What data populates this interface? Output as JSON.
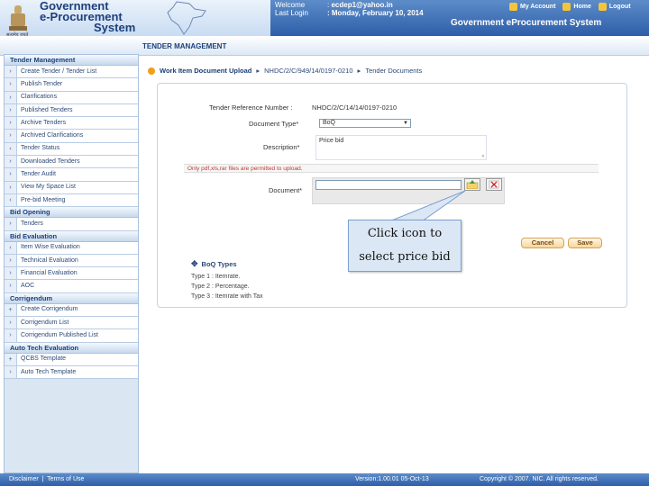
{
  "header": {
    "brand_line1": "Government",
    "brand_line2": "e-Procurement",
    "brand_line3": "System",
    "emblem_caption": "सत्यमेव जयते",
    "welcome_key": "Welcome",
    "welcome_sep": ":",
    "welcome_value": "ecdep1@yahoo.in",
    "lastlogin_key": "Last Login",
    "lastlogin_value": ": Monday, February 10, 2014",
    "link_account": "My Account",
    "link_home": "Home",
    "link_logout": "Logout",
    "system_name": "Government eProcurement System"
  },
  "strip_title": "TENDER MANAGEMENT",
  "sidebar": {
    "sections": [
      {
        "title": "Tender Management",
        "items": [
          {
            "label": "Create Tender / Tender List",
            "arrow": "›"
          },
          {
            "label": "Publish Tender",
            "arrow": "›"
          },
          {
            "label": "Clarifications",
            "arrow": "›"
          },
          {
            "label": "Published Tenders",
            "arrow": "›"
          },
          {
            "label": "Archive Tenders",
            "arrow": "›"
          },
          {
            "label": "Archived Clarifications",
            "arrow": "›"
          },
          {
            "label": "Tender Status",
            "arrow": "‹"
          },
          {
            "label": "Downloaded Tenders",
            "arrow": "›"
          },
          {
            "label": "Tender Audit",
            "arrow": "›"
          },
          {
            "label": "View My Space List",
            "arrow": "›"
          },
          {
            "label": "Pre-bid Meeting",
            "arrow": "‹"
          }
        ]
      },
      {
        "title": "Bid Opening",
        "items": [
          {
            "label": "Tenders",
            "arrow": "›"
          }
        ]
      },
      {
        "title": "Bid Evaluation",
        "items": [
          {
            "label": "Item Wise Evaluation",
            "arrow": "‹"
          },
          {
            "label": "Technical Evaluation",
            "arrow": "›"
          },
          {
            "label": "Financial Evaluation",
            "arrow": "›"
          },
          {
            "label": "AOC",
            "arrow": "›"
          }
        ]
      },
      {
        "title": "Corrigendum",
        "items": [
          {
            "label": "Create Corrigendum",
            "arrow": "+"
          },
          {
            "label": "Corrigendum List",
            "arrow": "›"
          },
          {
            "label": "Corrigendum Published List",
            "arrow": "›"
          }
        ]
      },
      {
        "title": "Auto Tech Evaluation",
        "items": [
          {
            "label": "QCBS Template",
            "arrow": "+"
          },
          {
            "label": "Auto Tech Template",
            "arrow": "›"
          }
        ]
      }
    ]
  },
  "breadcrumb": {
    "part1": "Work Item Document Upload",
    "part2": "NHDC/2/C/949/14/0197-0210",
    "part3": "Tender Documents"
  },
  "form": {
    "tender_ref_label": "Tender Reference Number :",
    "tender_ref_value": "NHDC/2/C/14/14/0197-0210",
    "doc_type_label": "Document Type*",
    "doc_type_value": "BoQ",
    "description_label": "Description*",
    "description_value": "Price bid",
    "warning": "Only pdf,xls,rar files are permitted to upload.",
    "document_label": "Document*",
    "document_value": ""
  },
  "callout": {
    "line1": "Click icon to",
    "line2": "select price bid"
  },
  "buttons": {
    "cancel": "Cancel",
    "save": "Save"
  },
  "boq": {
    "title": "BoQ Types",
    "type1": "Type 1 : Itemrate.",
    "type2": "Type 2 : Percentage.",
    "type3": "Type 3 : Itemrate with Tax"
  },
  "footer": {
    "disclaimer": "Disclaimer",
    "sep": "|",
    "terms": "Terms of Use",
    "version": "Version:1.00.01 05-Oct-13",
    "copyright": "Copyright © 2007. NIC. All rights reserved."
  },
  "colors": {
    "header_blue": "#2d5ea8",
    "link_blue": "#1c3f7a",
    "accent_orange": "#f29d1c",
    "warning_red": "#c0392b"
  }
}
